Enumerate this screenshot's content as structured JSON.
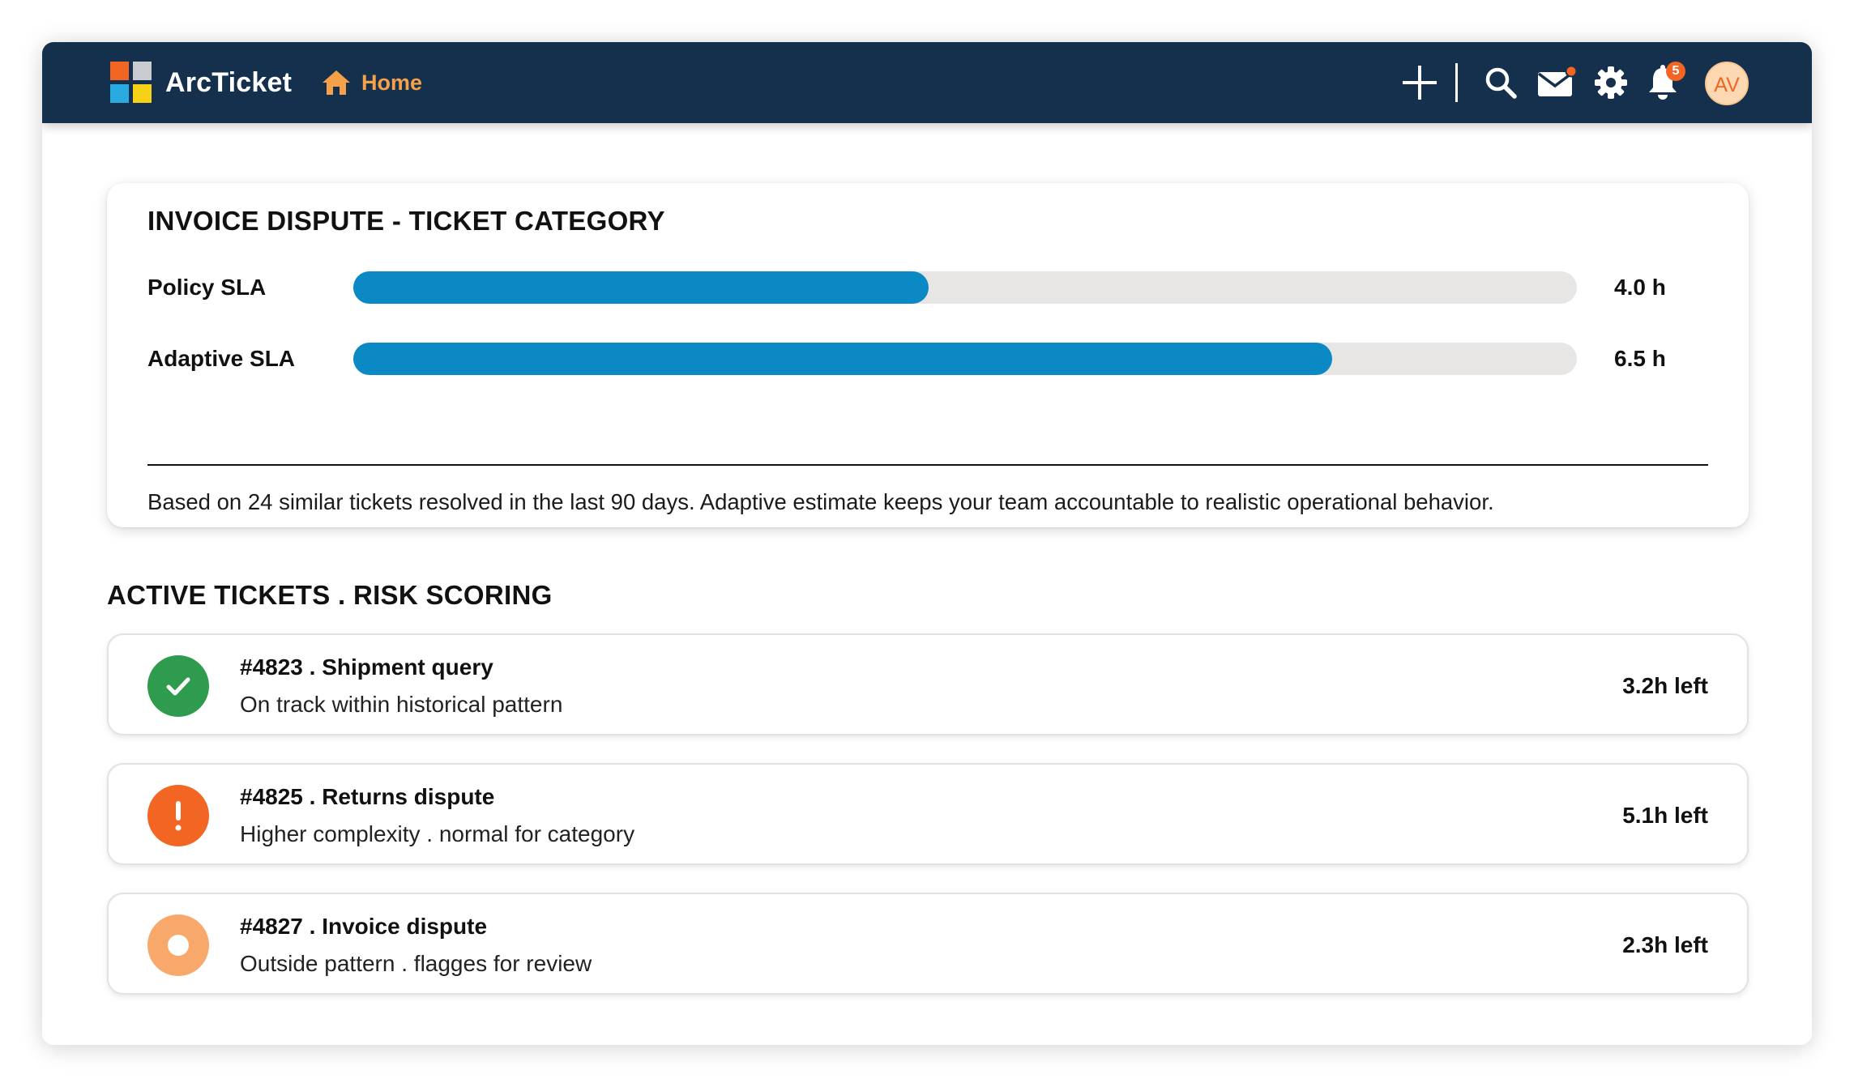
{
  "app": {
    "brand": "ArcTicket",
    "home_label": "Home",
    "notification_count": "5",
    "avatar_initials": "AV",
    "colors": {
      "header_bg": "#14304d",
      "accent_orange": "#f26522",
      "bar_fill": "#0a89c4",
      "bar_track": "#e8e6e4",
      "status_ok": "#2e9b4f",
      "status_warning": "#f26522",
      "status_review": "#f9a86b"
    },
    "icons": [
      "logo-icon",
      "home-icon",
      "plus-icon",
      "search-icon",
      "mail-icon",
      "gear-icon",
      "bell-icon"
    ]
  },
  "sla_card": {
    "title": "INVOICE DISPUTE - TICKET CATEGORY",
    "rows": [
      {
        "label": "Policy SLA",
        "value": "4.0 h",
        "fill_percent": 47
      },
      {
        "label": "Adaptive SLA",
        "value": "6.5 h",
        "fill_percent": 80
      }
    ],
    "note": "Based on 24 similar tickets resolved in the last 90 days. Adaptive estimate keeps your team accountable to realistic operational behavior."
  },
  "tickets_section": {
    "title": "ACTIVE TICKETS . RISK SCORING",
    "tickets": [
      {
        "title": "#4823 . Shipment query",
        "subtitle": "On track within historical pattern",
        "time_left": "3.2h left",
        "status_icon": "check-circle-icon"
      },
      {
        "title": "#4825 . Returns dispute",
        "subtitle": "Higher complexity . normal for category",
        "time_left": "5.1h left",
        "status_icon": "alert-circle-icon"
      },
      {
        "title": "#4827 . Invoice dispute",
        "subtitle": "Outside pattern . flagges for review",
        "time_left": "2.3h left",
        "status_icon": "ring-circle-icon"
      }
    ]
  }
}
